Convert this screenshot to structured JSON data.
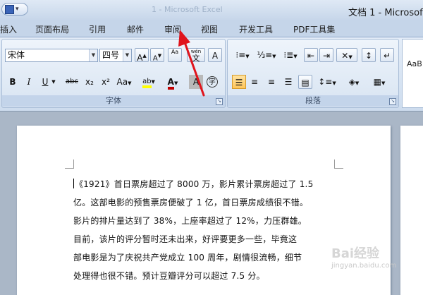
{
  "window": {
    "title": "文档 1 - Microsof",
    "ghost_title": "1 - Microsoft Excel"
  },
  "tabs": [
    "插入",
    "页面布局",
    "引用",
    "邮件",
    "审阅",
    "视图",
    "开发工具",
    "PDF工具集"
  ],
  "font_group": {
    "label": "字体",
    "font_name": "宋体",
    "font_size": "四号",
    "grow": "A",
    "shrink": "A",
    "bold": "B",
    "italic": "I",
    "underline": "U",
    "strike": "abc",
    "subscript": "x₂",
    "superscript": "x²",
    "change_case": "Aa",
    "highlight": "ab",
    "font_color": "A",
    "clear_format": "Aa",
    "phonetic": "wén",
    "phonetic_char": "文",
    "border_char": "A",
    "char_shading": "A",
    "enclose": "字"
  },
  "paragraph_group": {
    "label": "段落"
  },
  "styles_preview": "AaB",
  "document": {
    "lines": [
      "《1921》首日票房超过了 8000 万，影片累计票房超过了 1.5",
      "亿。这部电影的预售票房便破了 1 亿，首日票房成绩很不错。",
      "影片的排片量达到了 38%，上座率超过了 12%，力压群雄。",
      "目前，该片的评分暂时还未出来，好评要更多一些，毕竟这",
      "部电影是为了庆祝共产党成立 100 周年，剧情很流畅，细节",
      "处理得也很不错。预计豆瓣评分可以超过 7.5 分。"
    ]
  },
  "watermark": {
    "main": "Bai经验",
    "sub": "jingyan.baidu.com"
  },
  "colors": {
    "highlight": "#ffff00",
    "font_color": "#c00000",
    "annotation": "#e0141c"
  }
}
